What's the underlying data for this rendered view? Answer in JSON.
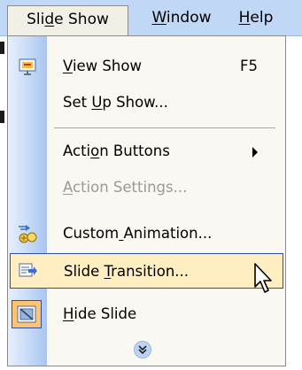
{
  "menubar": {
    "items": [
      {
        "label": "Slide Show",
        "mnemonic_index": 3,
        "active": true
      },
      {
        "label": "Window",
        "mnemonic_index": 0
      },
      {
        "label": "Help",
        "mnemonic_index": 0
      }
    ]
  },
  "menu": {
    "items": [
      {
        "label": "View Show",
        "mnemonic_index": 0,
        "shortcut": "F5",
        "icon": "view-show-icon"
      },
      {
        "label": "Set Up Show...",
        "mnemonic_index": 4
      },
      {
        "label": "Action Buttons",
        "mnemonic_index": 4,
        "submenu": true
      },
      {
        "label": "Action Settings...",
        "mnemonic_index": 0,
        "disabled": true
      },
      {
        "label": "Custom Animation...",
        "mnemonic_index": 6,
        "icon": "custom-animation-icon"
      },
      {
        "label": "Slide Transition...",
        "mnemonic_index": 6,
        "icon": "slide-transition-icon",
        "highlighted": true
      },
      {
        "label": "Hide Slide",
        "mnemonic_index": 0,
        "icon": "hide-slide-icon",
        "checked": true
      }
    ],
    "expand_icon": "double-chevron-down-icon"
  },
  "colors": {
    "menubar_bg": "#c1d7f6",
    "menu_bg": "#f9f8f3",
    "highlight_bg": "#ffeec2",
    "highlight_border": "#2d4f9e",
    "disabled_text": "#9a9a9a"
  }
}
